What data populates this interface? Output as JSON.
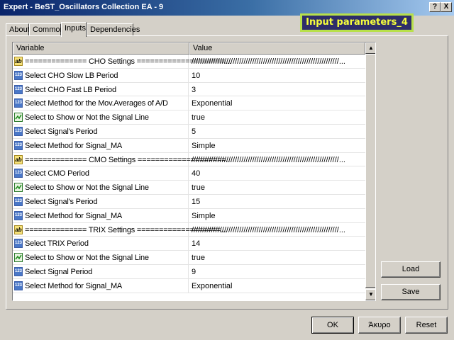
{
  "window": {
    "title": "Expert - BeST_Oscillators Collection EA - 9",
    "help_glyph": "?",
    "close_glyph": "X"
  },
  "tabs": [
    {
      "label": "About"
    },
    {
      "label": "Common"
    },
    {
      "label": "Inputs",
      "active": true
    },
    {
      "label": "Dependencies"
    }
  ],
  "badge": {
    "text": "Input parameters_4"
  },
  "grid": {
    "columns": {
      "variable": "Variable",
      "value": "Value"
    },
    "rows": [
      {
        "icon": "ab",
        "variable": "============== CHO Settings ====================...",
        "value": "////////////////////////////////////////////////////////////////////..."
      },
      {
        "icon": "123",
        "variable": "Select CHO Slow LB Period",
        "value": "10"
      },
      {
        "icon": "123",
        "variable": "Select CHO Fast LB Period",
        "value": "3"
      },
      {
        "icon": "123",
        "variable": "Select Method for the Mov.Averages of A/D",
        "value": "Exponential"
      },
      {
        "icon": "sig",
        "variable": "Select to Show or Not the Signal Line",
        "value": "true"
      },
      {
        "icon": "123",
        "variable": "Select Signal's Period",
        "value": "5"
      },
      {
        "icon": "123",
        "variable": "Select Method for Signal_MA",
        "value": "Simple"
      },
      {
        "icon": "ab",
        "variable": "============== CMO Settings ====================...",
        "value": "////////////////////////////////////////////////////////////////////..."
      },
      {
        "icon": "123",
        "variable": "Select CMO Period",
        "value": "40"
      },
      {
        "icon": "sig",
        "variable": "Select to Show or Not the Signal Line",
        "value": "true"
      },
      {
        "icon": "123",
        "variable": "Select Signal's Period",
        "value": "15"
      },
      {
        "icon": "123",
        "variable": "Select Method for Signal_MA",
        "value": "Simple"
      },
      {
        "icon": "ab",
        "variable": "============== TRIX Settings ===================...",
        "value": "////////////////////////////////////////////////////////////////////..."
      },
      {
        "icon": "123",
        "variable": "Select TRIX Period",
        "value": "14"
      },
      {
        "icon": "sig",
        "variable": "Select to Show or Not the Signal Line",
        "value": "true"
      },
      {
        "icon": "123",
        "variable": "Select Signal Period",
        "value": "9"
      },
      {
        "icon": "123",
        "variable": "Select Method for Signal_MA",
        "value": "Exponential"
      }
    ]
  },
  "side_buttons": {
    "load": "Load",
    "save": "Save"
  },
  "footer_buttons": {
    "ok": "OK",
    "cancel": "Άκυρο",
    "reset": "Reset"
  }
}
